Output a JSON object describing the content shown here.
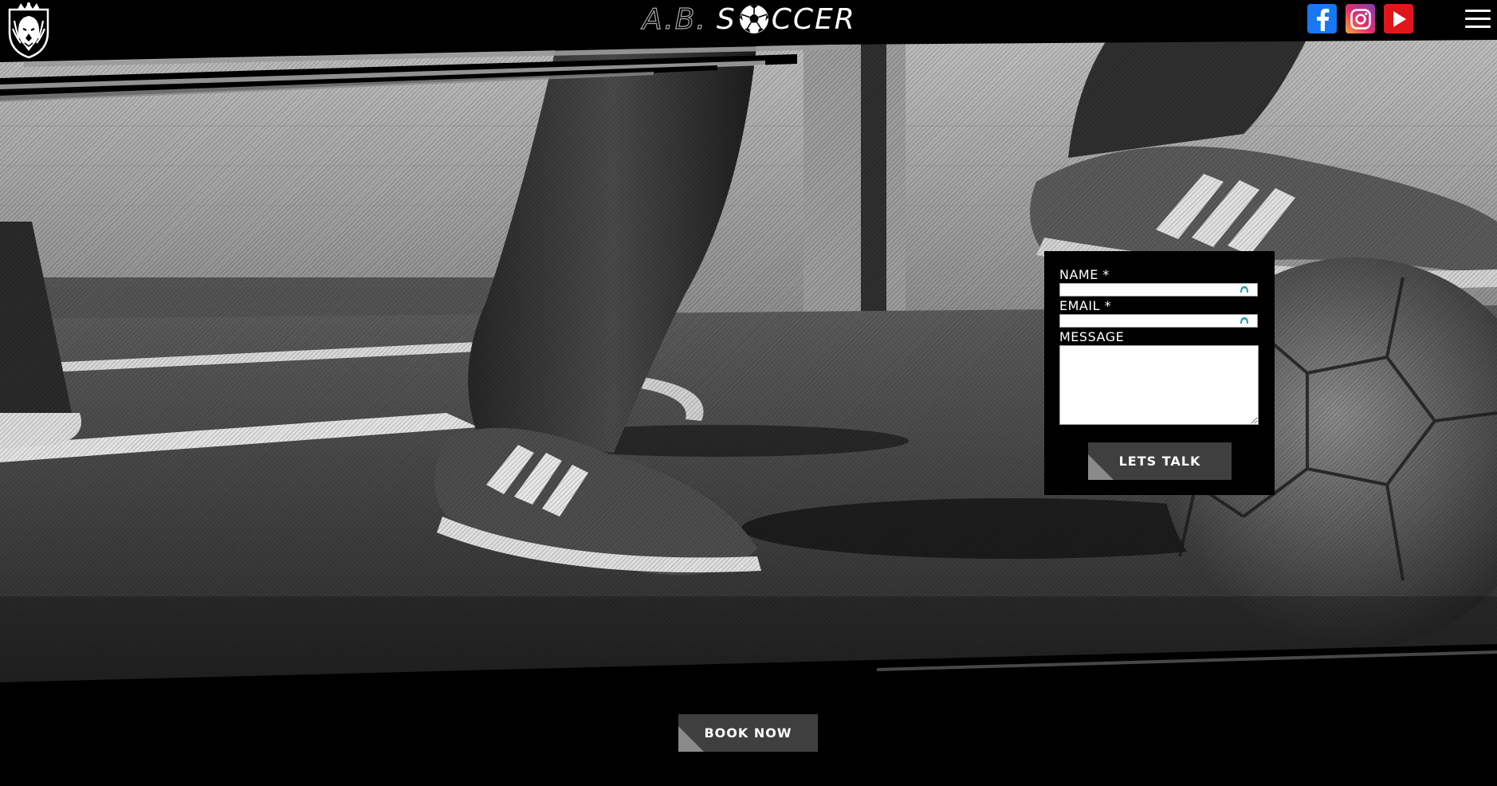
{
  "header": {
    "brand_prefix": "A.B.",
    "brand_first_letter": "S",
    "brand_rest": "CCER",
    "logo_icon": "lion-crest-icon",
    "social_links": [
      {
        "name": "facebook",
        "icon": "facebook-icon",
        "color": "#1877f2"
      },
      {
        "name": "instagram",
        "icon": "instagram-icon",
        "color": "#e1306c"
      },
      {
        "name": "youtube",
        "icon": "youtube-icon",
        "color": "#e1161b"
      }
    ],
    "menu_icon": "hamburger-menu-icon"
  },
  "hero": {
    "image_subject": "street soccer players' feet with a soccer ball, black and white"
  },
  "contact_form": {
    "name_label": "NAME *",
    "name_value": "",
    "email_label": "EMAIL *",
    "email_value": "",
    "message_label": "MESSAGE",
    "message_value": "",
    "submit_label": "LETS TALK"
  },
  "book_now_label": "BOOK NOW",
  "colors": {
    "background": "#000000",
    "button": "#3f3f3f",
    "button_accent": "#8a8a8a",
    "autofill_accent": "#2a9aa8"
  }
}
